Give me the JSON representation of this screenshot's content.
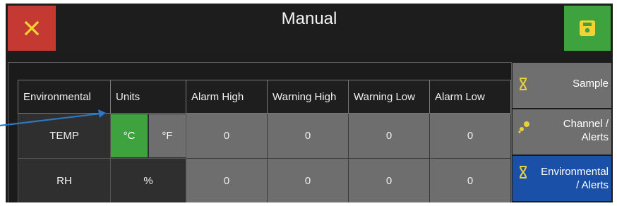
{
  "header": {
    "title": "Manual",
    "close_icon": "close-icon",
    "save_icon": "save-icon",
    "colors": {
      "close": "#c43a33",
      "save": "#3ea33e",
      "background": "#1d1d1d"
    }
  },
  "table": {
    "columns": [
      "Environmental",
      "Units",
      "Alarm High",
      "Warning High",
      "Warning Low",
      "Alarm Low"
    ],
    "rows": [
      {
        "name": "TEMP",
        "units": [
          "°C",
          "°F"
        ],
        "selected_unit": "°C",
        "values": [
          "0",
          "0",
          "0",
          "0"
        ]
      },
      {
        "name": "RH",
        "units": [
          "%"
        ],
        "values": [
          "0",
          "0",
          "0",
          "0"
        ]
      }
    ]
  },
  "side_nav": {
    "items": [
      {
        "label": "Sample",
        "icon": "hourglass-icon",
        "active": false
      },
      {
        "label": "Channel /\nAlerts",
        "icon": "scatter-dots-icon",
        "active": false
      },
      {
        "label": "Environmental\n/ Alerts",
        "icon": "hourglass-icon",
        "active": true
      }
    ],
    "colors": {
      "active": "#1a50a8",
      "inactive": "#6f6f6f",
      "icon": "#e8d23a"
    }
  }
}
